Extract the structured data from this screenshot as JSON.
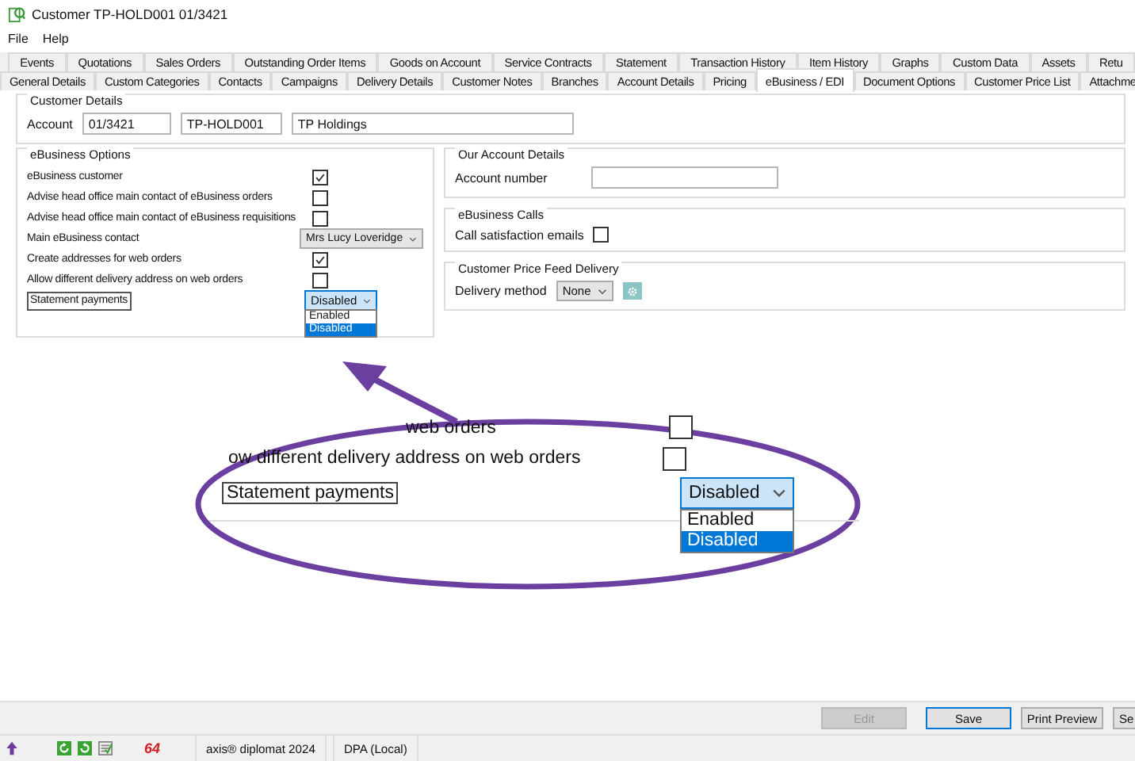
{
  "window": {
    "title": "Customer TP-HOLD001 01/3421"
  },
  "menu": [
    "File",
    "Help"
  ],
  "tabs_row_1": [
    {
      "label": "Events",
      "selected": false
    },
    {
      "label": "Quotations",
      "selected": false
    },
    {
      "label": "Sales Orders",
      "selected": false
    },
    {
      "label": "Outstanding Order Items",
      "selected": false
    },
    {
      "label": "Goods on Account",
      "selected": false
    },
    {
      "label": "Service Contracts",
      "selected": false
    },
    {
      "label": "Statement",
      "selected": false
    },
    {
      "label": "Transaction History",
      "selected": false
    },
    {
      "label": "Item History",
      "selected": false
    },
    {
      "label": "Graphs",
      "selected": false
    },
    {
      "label": "Custom Data",
      "selected": false
    },
    {
      "label": "Assets",
      "selected": false
    },
    {
      "label": "Retu",
      "selected": false
    }
  ],
  "tabs_row_2": [
    {
      "label": "General Details",
      "selected": false
    },
    {
      "label": "Custom Categories",
      "selected": false
    },
    {
      "label": "Contacts",
      "selected": false
    },
    {
      "label": "Campaigns",
      "selected": false
    },
    {
      "label": "Delivery Details",
      "selected": false
    },
    {
      "label": "Customer Notes",
      "selected": false
    },
    {
      "label": "Branches",
      "selected": false
    },
    {
      "label": "Account Details",
      "selected": false
    },
    {
      "label": "Pricing",
      "selected": false
    },
    {
      "label": "eBusiness / EDI",
      "selected": true
    },
    {
      "label": "Document Options",
      "selected": false
    },
    {
      "label": "Customer Price List",
      "selected": false
    },
    {
      "label": "Attachme",
      "selected": false
    }
  ],
  "customer_details": {
    "title": "Customer Details",
    "label": "Account",
    "fields": [
      "01/3421",
      "TP-HOLD001",
      "TP Holdings"
    ]
  },
  "ebusiness_options": {
    "title": "eBusiness Options",
    "rows": [
      {
        "kind": "checkbox",
        "label": "eBusiness customer",
        "checked": true
      },
      {
        "kind": "checkbox",
        "label": "Advise head office main contact of eBusiness orders",
        "checked": false
      },
      {
        "kind": "checkbox",
        "label": "Advise head office main contact of eBusiness requisitions",
        "checked": false
      },
      {
        "kind": "select",
        "label": "Main eBusiness contact",
        "value": "Mrs Lucy Loveridge"
      },
      {
        "kind": "checkbox",
        "label": "Create addresses for web orders",
        "checked": true
      },
      {
        "kind": "checkbox",
        "label": "Allow different delivery address on web orders",
        "checked": false
      },
      {
        "kind": "dropdown_open",
        "label": "Statement payments",
        "focused": true,
        "value": "Disabled",
        "options": [
          {
            "label": "Enabled",
            "selected": false
          },
          {
            "label": "Disabled",
            "selected": true
          }
        ]
      }
    ]
  },
  "our_account_details": {
    "title": "Our Account Details",
    "label": "Account number"
  },
  "ebusiness_calls": {
    "title": "eBusiness Calls",
    "label": "Call satisfaction emails",
    "checked": false
  },
  "price_feed": {
    "title": "Customer Price Feed Delivery",
    "label": "Delivery method",
    "value": "None"
  },
  "callout": {
    "rows": [
      {
        "kind": "checkbox",
        "label": "web orders",
        "checked": false
      },
      {
        "kind": "checkbox",
        "label": "ow different delivery address on web orders",
        "checked": false
      },
      {
        "kind": "dropdown_open",
        "label": "Statement payments",
        "focused": true,
        "value": "Disabled",
        "options": [
          {
            "label": "Enabled",
            "selected": false
          },
          {
            "label": "Disabled",
            "selected": true
          }
        ]
      }
    ]
  },
  "buttons": [
    {
      "label": "Edit",
      "disabled": true,
      "focused": false
    },
    {
      "label": "Save",
      "disabled": false,
      "focused": true
    },
    {
      "label": "Print Preview",
      "disabled": false,
      "focused": false
    },
    {
      "label": "Se",
      "disabled": false,
      "focused": false
    }
  ],
  "status_bar": {
    "badge": "64",
    "product": "axis® diplomat 2024",
    "database": "DPA (Local)"
  }
}
